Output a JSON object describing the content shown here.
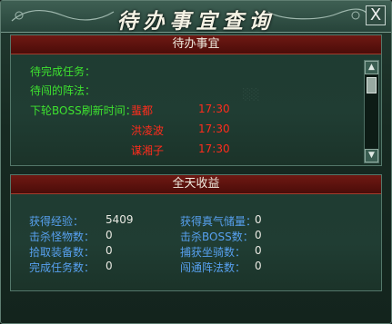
{
  "window": {
    "title": "待办事宜查询",
    "close_label": "X"
  },
  "todo": {
    "header": "待办事宜",
    "pending_tasks_label": "待完成任务：",
    "pending_formation_label": "待闯的阵法：",
    "boss_label": "下轮BOSS刷新时间：",
    "bosses": [
      {
        "name": "蜚都",
        "time": "17:30"
      },
      {
        "name": "洪凌波",
        "time": "17:30"
      },
      {
        "name": "谋湘子",
        "time": "17:30"
      }
    ]
  },
  "income": {
    "header": "全天收益",
    "left": [
      {
        "label": "获得经验：",
        "value": "5409"
      },
      {
        "label": "击杀怪物数：",
        "value": "0"
      },
      {
        "label": "拾取装备数：",
        "value": "0"
      },
      {
        "label": "完成任务数：",
        "value": "0"
      }
    ],
    "right": [
      {
        "label": "获得真气储量：",
        "value": "0"
      },
      {
        "label": "击杀BOSS数：",
        "value": "0"
      },
      {
        "label": "捕获坐骑数：",
        "value": "0"
      },
      {
        "label": "闯通阵法数：",
        "value": "0"
      }
    ]
  },
  "colors": {
    "green_text": "#3ee22f",
    "red_text": "#ff2c1c",
    "blue_text": "#57a0ef",
    "header_bg": "#6f1913"
  }
}
